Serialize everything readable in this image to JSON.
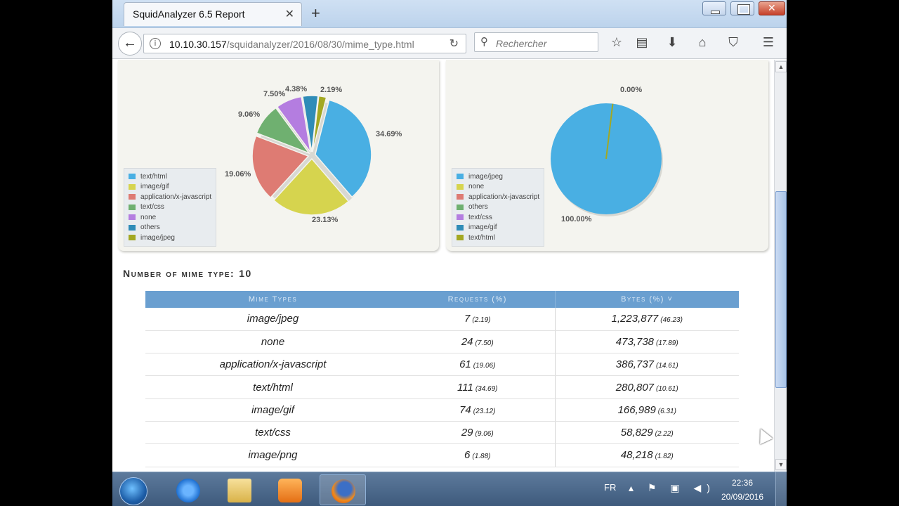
{
  "browser": {
    "tab_title": "SquidAnalyzer 6.5 Report",
    "url_host": "10.10.30.157",
    "url_path": "/squidanalyzer/2016/08/30/mime_type.html",
    "search_placeholder": "Rechercher"
  },
  "left_chart": {
    "legend": [
      {
        "label": "text/html",
        "color": "#49afe3"
      },
      {
        "label": "image/gif",
        "color": "#d6d44e"
      },
      {
        "label": "application/x-javascript",
        "color": "#de7b73"
      },
      {
        "label": "text/css",
        "color": "#6fb070"
      },
      {
        "label": "none",
        "color": "#b47de0"
      },
      {
        "label": "others",
        "color": "#2f8cb7"
      },
      {
        "label": "image/jpeg",
        "color": "#a3a822"
      }
    ],
    "labels": [
      "34.69%",
      "23.13%",
      "19.06%",
      "9.06%",
      "7.50%",
      "4.38%",
      "2.19%"
    ]
  },
  "right_chart": {
    "legend": [
      {
        "label": "image/jpeg",
        "color": "#49afe3"
      },
      {
        "label": "none",
        "color": "#d6d44e"
      },
      {
        "label": "application/x-javascript",
        "color": "#de7b73"
      },
      {
        "label": "others",
        "color": "#6fb070"
      },
      {
        "label": "text/css",
        "color": "#b47de0"
      },
      {
        "label": "image/gif",
        "color": "#2f8cb7"
      },
      {
        "label": "text/html",
        "color": "#a3a822"
      }
    ],
    "labels": [
      "0.00%",
      "100.00%"
    ]
  },
  "summary": {
    "label": "Number of mime type:",
    "value": "10"
  },
  "table": {
    "headers": [
      "Mime Types",
      "Requests (%)",
      "Bytes (%) ˅"
    ],
    "rows": [
      {
        "type": "image/jpeg",
        "requests": "7",
        "req_pct": "(2.19)",
        "bytes": "1,223,877",
        "bytes_pct": "(46.23)"
      },
      {
        "type": "none",
        "requests": "24",
        "req_pct": "(7.50)",
        "bytes": "473,738",
        "bytes_pct": "(17.89)"
      },
      {
        "type": "application/x-javascript",
        "requests": "61",
        "req_pct": "(19.06)",
        "bytes": "386,737",
        "bytes_pct": "(14.61)"
      },
      {
        "type": "text/html",
        "requests": "111",
        "req_pct": "(34.69)",
        "bytes": "280,807",
        "bytes_pct": "(10.61)"
      },
      {
        "type": "image/gif",
        "requests": "74",
        "req_pct": "(23.12)",
        "bytes": "166,989",
        "bytes_pct": "(6.31)"
      },
      {
        "type": "text/css",
        "requests": "29",
        "req_pct": "(9.06)",
        "bytes": "58,829",
        "bytes_pct": "(2.22)"
      },
      {
        "type": "image/png",
        "requests": "6",
        "req_pct": "(1.88)",
        "bytes": "48,218",
        "bytes_pct": "(1.82)"
      }
    ]
  },
  "taskbar": {
    "language": "FR",
    "time": "22:36",
    "date": "20/09/2016"
  },
  "chart_data": [
    {
      "type": "pie",
      "slices": [
        {
          "label": "text/html",
          "value": 34.69,
          "color": "#49afe3"
        },
        {
          "label": "image/gif",
          "value": 23.13,
          "color": "#d6d44e"
        },
        {
          "label": "application/x-javascript",
          "value": 19.06,
          "color": "#de7b73"
        },
        {
          "label": "text/css",
          "value": 9.06,
          "color": "#6fb070"
        },
        {
          "label": "none",
          "value": 7.5,
          "color": "#b47de0"
        },
        {
          "label": "others",
          "value": 4.38,
          "color": "#2f8cb7"
        },
        {
          "label": "image/jpeg",
          "value": 2.19,
          "color": "#a3a822"
        }
      ]
    },
    {
      "type": "pie",
      "slices": [
        {
          "label": "image/jpeg",
          "value": 100.0,
          "color": "#49afe3"
        },
        {
          "label": "text/html",
          "value": 0.0,
          "color": "#a3a822"
        }
      ]
    }
  ]
}
